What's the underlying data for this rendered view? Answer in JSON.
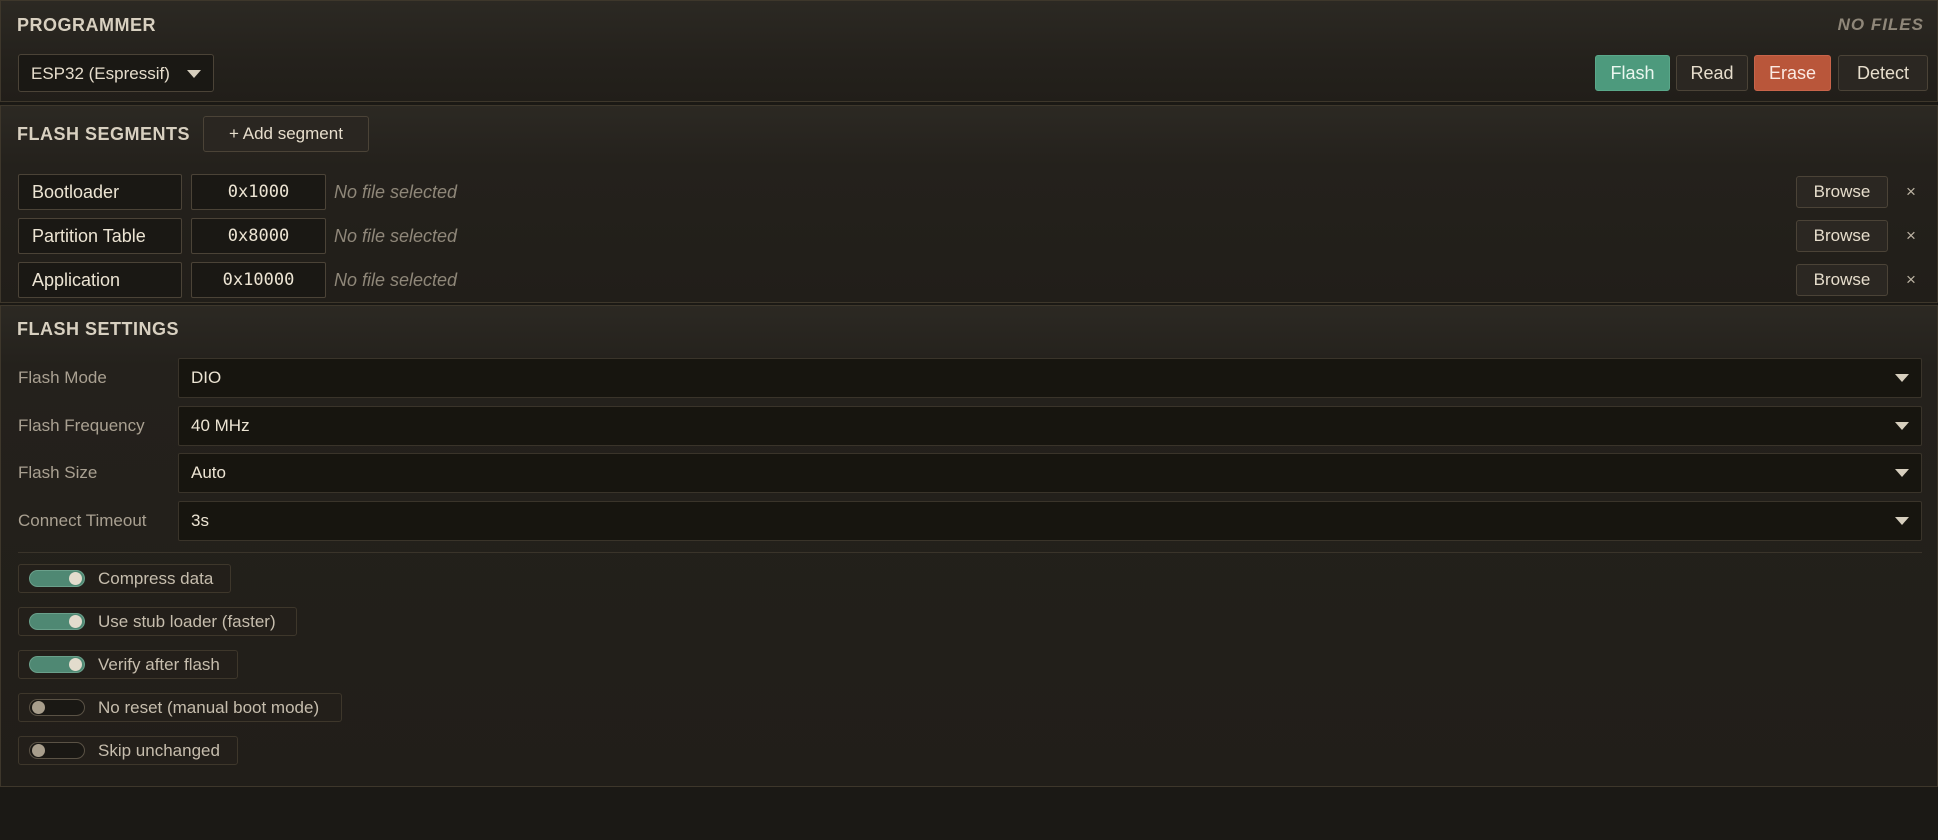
{
  "programmer": {
    "title": "PROGRAMMER",
    "status": "NO FILES",
    "device": "ESP32 (Espressif)",
    "buttons": {
      "flash": "Flash",
      "read": "Read",
      "erase": "Erase",
      "detect": "Detect"
    },
    "colors": {
      "flash": "#4d9a7d",
      "erase": "#b9563a"
    }
  },
  "segments": {
    "title": "FLASH SEGMENTS",
    "add_label": "+ Add segment",
    "rows": [
      {
        "name": "Bootloader",
        "address": "0x1000",
        "file": "No file selected",
        "browse": "Browse",
        "remove": "×"
      },
      {
        "name": "Partition Table",
        "address": "0x8000",
        "file": "No file selected",
        "browse": "Browse",
        "remove": "×"
      },
      {
        "name": "Application",
        "address": "0x10000",
        "file": "No file selected",
        "browse": "Browse",
        "remove": "×"
      }
    ]
  },
  "settings": {
    "title": "FLASH SETTINGS",
    "fields": [
      {
        "label": "Flash Mode",
        "value": "DIO"
      },
      {
        "label": "Flash Frequency",
        "value": "40 MHz"
      },
      {
        "label": "Flash Size",
        "value": "Auto"
      },
      {
        "label": "Connect Timeout",
        "value": "3s"
      }
    ],
    "toggles": [
      {
        "label": "Compress data",
        "on": true
      },
      {
        "label": "Use stub loader (faster)",
        "on": true
      },
      {
        "label": "Verify after flash",
        "on": true
      },
      {
        "label": "No reset (manual boot mode)",
        "on": false
      },
      {
        "label": "Skip unchanged",
        "on": false
      }
    ]
  }
}
